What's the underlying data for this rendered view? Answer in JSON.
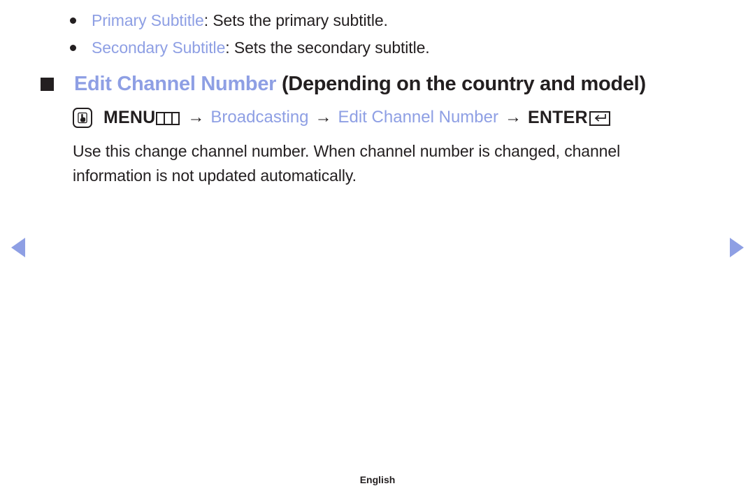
{
  "colors": {
    "link_blue": "#8e9fe4",
    "text_dark": "#231f20",
    "background": "#ffffff"
  },
  "bullet_list": {
    "items": [
      {
        "term": "Primary Subtitle",
        "description": ": Sets the primary subtitle."
      },
      {
        "term": "Secondary Subtitle",
        "description": ": Sets the secondary subtitle."
      }
    ]
  },
  "section": {
    "heading_link": "Edit Channel Number",
    "heading_note": "(Depending on the country and model)"
  },
  "menu_path": {
    "touch_icon": "hand-press-icon",
    "menu_label": "MENU",
    "menu_bars_icon": "three-bars-icon",
    "separator": "→",
    "step1": "Broadcasting",
    "step2": "Edit Channel Number",
    "enter_label": "ENTER",
    "enter_icon": "enter-return-icon"
  },
  "body": {
    "paragraph": "Use this change channel number. When channel number is changed, channel information is not updated automatically."
  },
  "navigation": {
    "prev_icon": "triangle-left-icon",
    "next_icon": "triangle-right-icon"
  },
  "footer": {
    "language": "English"
  }
}
